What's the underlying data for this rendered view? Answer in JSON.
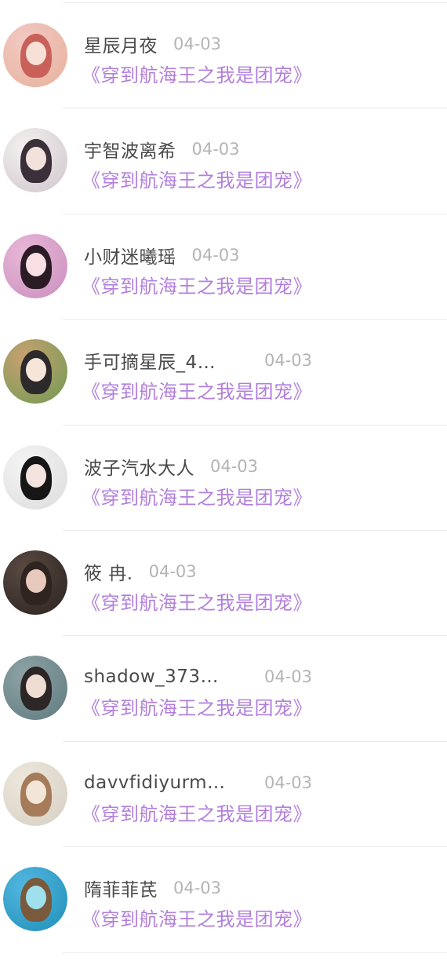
{
  "comments": [
    {
      "name": "星辰月夜",
      "date": "04-03",
      "book": "《穿到航海王之我是团宠》",
      "truncated": false,
      "avatar": {
        "bg1": "#f2c9c3",
        "bg2": "#e7b19b",
        "hair": "#c9605a",
        "face": "#f7e1d6"
      }
    },
    {
      "name": "宇智波离希",
      "date": "04-03",
      "book": "《穿到航海王之我是团宠》",
      "truncated": false,
      "avatar": {
        "bg1": "#f4f1ef",
        "bg2": "#cfc6cc",
        "hair": "#3b2f3a",
        "face": "#f2e2dc"
      }
    },
    {
      "name": "小财迷曦瑶",
      "date": "04-03",
      "book": "《穿到航海王之我是团宠》",
      "truncated": false,
      "avatar": {
        "bg1": "#e9b7d6",
        "bg2": "#c98fbf",
        "hair": "#2b1b25",
        "face": "#f7dfe3"
      }
    },
    {
      "name": "手可摘星辰_4…",
      "date": "04-03",
      "book": "《穿到航海王之我是团宠》",
      "truncated": true,
      "avatar": {
        "bg1": "#c9a072",
        "bg2": "#6f9b52",
        "hair": "#2c2a2a",
        "face": "#f5e6d9"
      }
    },
    {
      "name": "波子汽水大人",
      "date": "04-03",
      "book": "《穿到航海王之我是团宠》",
      "truncated": false,
      "avatar": {
        "bg1": "#f4f4f4",
        "bg2": "#dcdcdc",
        "hair": "#161616",
        "face": "#f3e4df"
      }
    },
    {
      "name": "筱 冉.",
      "date": "04-03",
      "book": "《穿到航海王之我是团宠》",
      "truncated": false,
      "avatar": {
        "bg1": "#5a4a42",
        "bg2": "#2a2220",
        "hair": "#2f2420",
        "face": "#e8c9bd"
      }
    },
    {
      "name": "shadow_373…",
      "date": "04-03",
      "book": "《穿到航海王之我是团宠》",
      "truncated": true,
      "avatar": {
        "bg1": "#8ea3a6",
        "bg2": "#5f7a7e",
        "hair": "#2d2626",
        "face": "#efdcd3"
      }
    },
    {
      "name": "davvfidiyurm…",
      "date": "04-03",
      "book": "《穿到航海王之我是团宠》",
      "truncated": true,
      "avatar": {
        "bg1": "#eee7dc",
        "bg2": "#d6cfc3",
        "hair": "#a57b5a",
        "face": "#f3e6d8"
      }
    },
    {
      "name": "隋菲菲芪",
      "date": "04-03",
      "book": "《穿到航海王之我是团宠》",
      "truncated": false,
      "avatar": {
        "bg1": "#53b7e0",
        "bg2": "#1f8fb8",
        "hair": "#7a5a3c",
        "face": "#9fe0ee"
      }
    }
  ],
  "colors": {
    "name_text": "#4a4a4a",
    "date_text": "#b4b4b4",
    "book_title": "#b27fdc",
    "divider": "#ececec"
  }
}
